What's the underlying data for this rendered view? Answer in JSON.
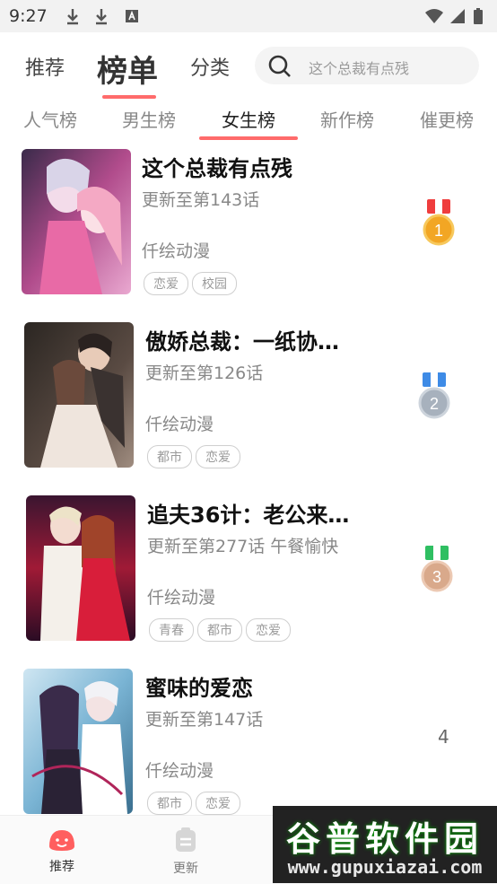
{
  "status_bar": {
    "time": "9:27"
  },
  "top_tabs": [
    {
      "label": "推荐"
    },
    {
      "label": "榜单"
    },
    {
      "label": "分类"
    }
  ],
  "search": {
    "placeholder": "这个总裁有点残"
  },
  "sub_tabs": [
    {
      "label": "人气榜"
    },
    {
      "label": "男生榜"
    },
    {
      "label": "女生榜"
    },
    {
      "label": "新作榜"
    },
    {
      "label": "催更榜"
    }
  ],
  "items": [
    {
      "title": "这个总裁有点残",
      "update": "更新至第143话",
      "author": "仟绘动漫",
      "tags": [
        "恋爱",
        "校园"
      ],
      "rank": "1",
      "medal_color": "#f2a624",
      "ribbon_color": "#ef3d3d"
    },
    {
      "title": "傲娇总裁：一纸协…",
      "update": "更新至第126话",
      "author": "仟绘动漫",
      "tags": [
        "都市",
        "恋爱"
      ],
      "rank": "2",
      "medal_color": "#a7b1bd",
      "ribbon_color": "#3e8be6"
    },
    {
      "title": "追夫36计：老公来…",
      "update": "更新至第277话 午餐愉快",
      "author": "仟绘动漫",
      "tags": [
        "青春",
        "都市",
        "恋爱"
      ],
      "rank": "3",
      "medal_color": "#d9a98b",
      "ribbon_color": "#2fbf62"
    },
    {
      "title": "蜜味的爱恋",
      "update": "更新至第147话",
      "author": "仟绘动漫",
      "tags": [
        "都市",
        "恋爱"
      ],
      "rank": "4"
    }
  ],
  "bottom_nav": [
    {
      "label": "推荐"
    },
    {
      "label": "更新"
    }
  ],
  "watermark": {
    "line1": "谷普软件园",
    "line2": "www.gupuxiazai.com"
  },
  "colors": {
    "accent": "#ff6b6b"
  }
}
